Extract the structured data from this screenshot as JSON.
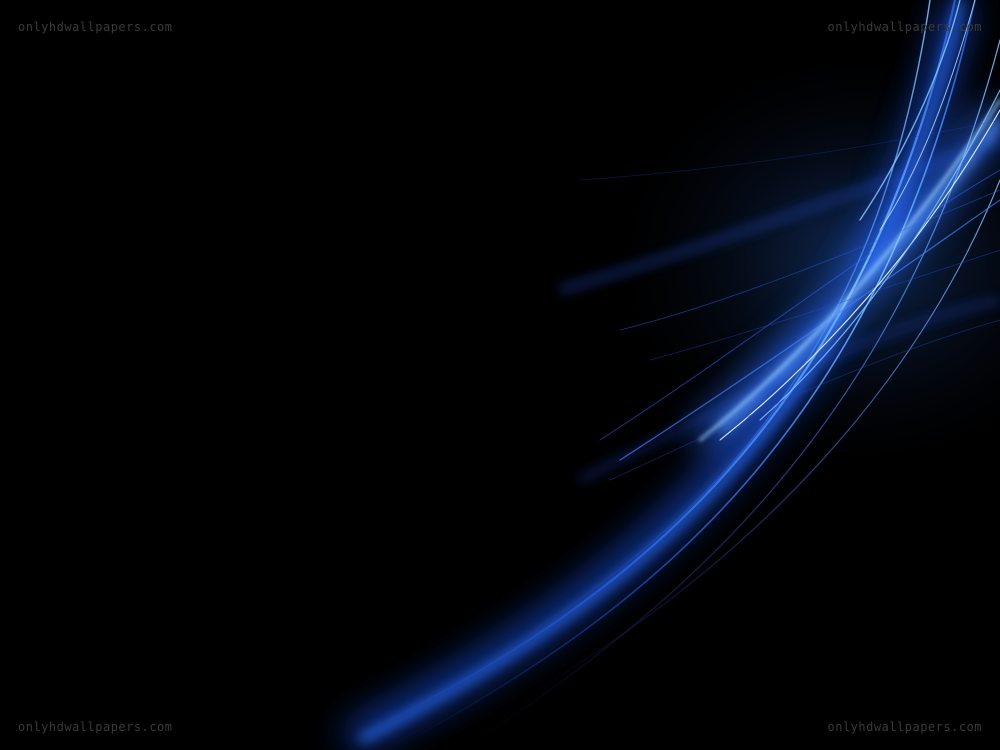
{
  "wallpaper": {
    "description_colors": {
      "background": "#000000",
      "streak_primary": "#2a6bff",
      "streak_highlight": "#9fd4ff",
      "streak_deep": "#1a3fbf"
    },
    "watermarks": {
      "top_left": "onlyhdwallpapers.com",
      "top_right": "onlyhdwallpapers.com",
      "bottom_left": "onlyhdwallpapers.com",
      "bottom_right": "onlyhdwallpapers.com"
    }
  }
}
